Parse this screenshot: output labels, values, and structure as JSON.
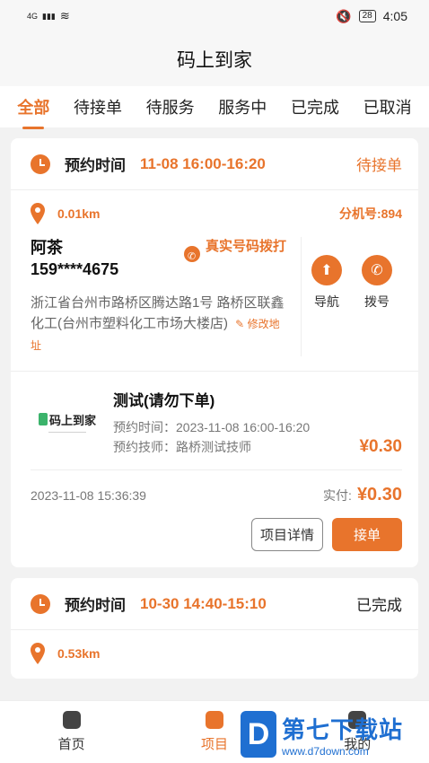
{
  "status_bar": {
    "signal": "4G",
    "battery": "28",
    "time": "4:05"
  },
  "app": {
    "title": "码上到家"
  },
  "tabs": [
    {
      "label": "全部",
      "active": true
    },
    {
      "label": "待接单"
    },
    {
      "label": "待服务"
    },
    {
      "label": "服务中"
    },
    {
      "label": "已完成"
    },
    {
      "label": "已取消"
    }
  ],
  "orders": [
    {
      "time_label": "预约时间",
      "time": "11-08 16:00-16:20",
      "status": "待接单",
      "distance": "0.01km",
      "extension": "分机号:894",
      "customer_name": "阿茶",
      "customer_phone": "159****4675",
      "real_call": "真实号码拨打",
      "address": "浙江省台州市路桥区腾达路1号 路桥区联鑫化工(台州市塑料化工市场大楼店)",
      "modify_address": "修改地址",
      "nav_label": "导航",
      "dial_label": "拨号",
      "item": {
        "logo_text": "码上到家",
        "title": "测试(请勿下单)",
        "appointment_time": "预约时间：2023-11-08 16:00-16:20",
        "technician": "预约技师：路桥测试技师",
        "price": "¥0.30"
      },
      "created_at": "2023-11-08 15:36:39",
      "paid_label": "实付:",
      "paid_amount": "¥0.30",
      "detail_button": "项目详情",
      "accept_button": "接单"
    },
    {
      "time_label": "预约时间",
      "time": "10-30 14:40-15:10",
      "status": "已完成",
      "distance": "0.53km"
    }
  ],
  "bottom_nav": [
    {
      "label": "首页",
      "icon": "home-icon"
    },
    {
      "label": "项目",
      "icon": "clipboard-icon",
      "active": true
    },
    {
      "label": "我的",
      "icon": "user-icon"
    }
  ],
  "watermark": {
    "title": "第七下载站",
    "url": "www.d7down.com"
  },
  "colors": {
    "accent": "#e8742c",
    "watermark": "#1f6fd1"
  }
}
